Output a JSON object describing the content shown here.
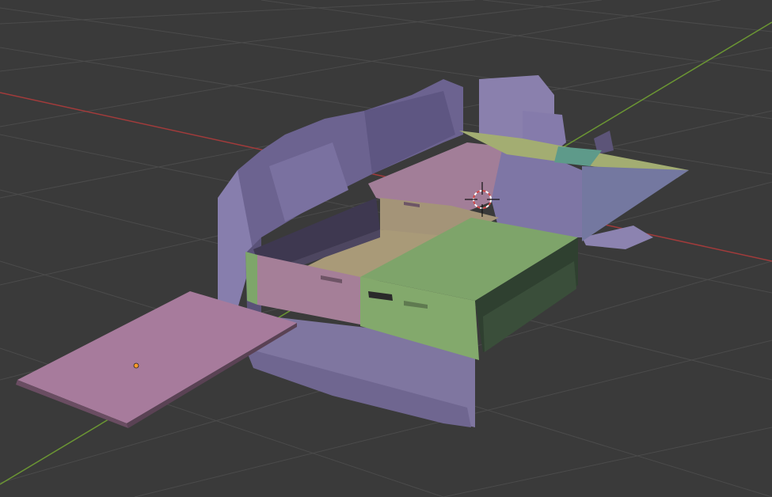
{
  "viewport": {
    "background": "#3a3a3a",
    "grid_color": "#4a4a4a",
    "x_axis_color": "#b23a3a",
    "y_axis_color": "#6f9a2c",
    "cursor_color": "#d24a4a"
  },
  "scene": {
    "vehicle_scan_color": "#857aa6",
    "vehicle_dark_color": "#5c5478",
    "panel_pink_color": "#a4809a",
    "panel_tan_color": "#a99977",
    "panel_green_color": "#7fa369",
    "panel_blue_color": "#7478a0",
    "panel_yellow_color": "#a3ac72",
    "selected_plate_color": "#a77b9c",
    "origin_dot_color": "#ff9a2a"
  }
}
